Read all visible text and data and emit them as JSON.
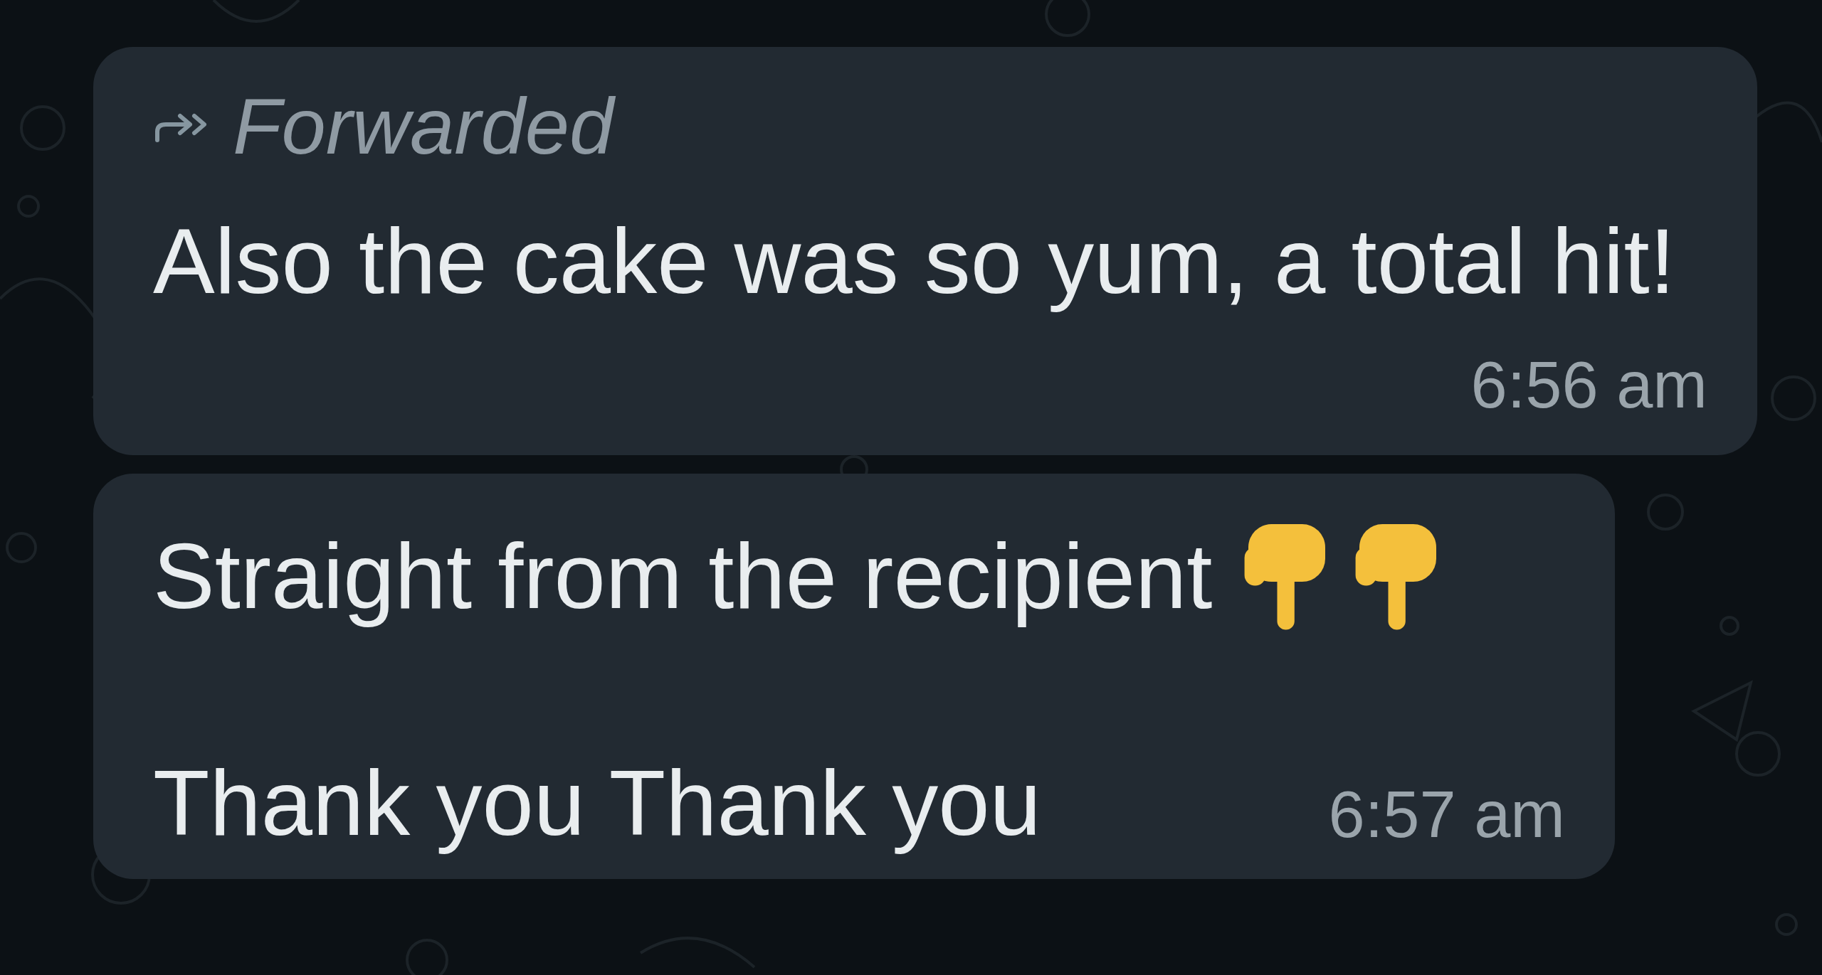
{
  "messages": [
    {
      "forwarded": true,
      "forward_label": "Forwarded",
      "lines": [
        "Also the cake was so yum, a total hit!"
      ],
      "time": "6:56 am"
    },
    {
      "forwarded": false,
      "lines": [
        "Straight from the recipient",
        "Thank you Thank you"
      ],
      "time": "6:57 am"
    }
  ]
}
